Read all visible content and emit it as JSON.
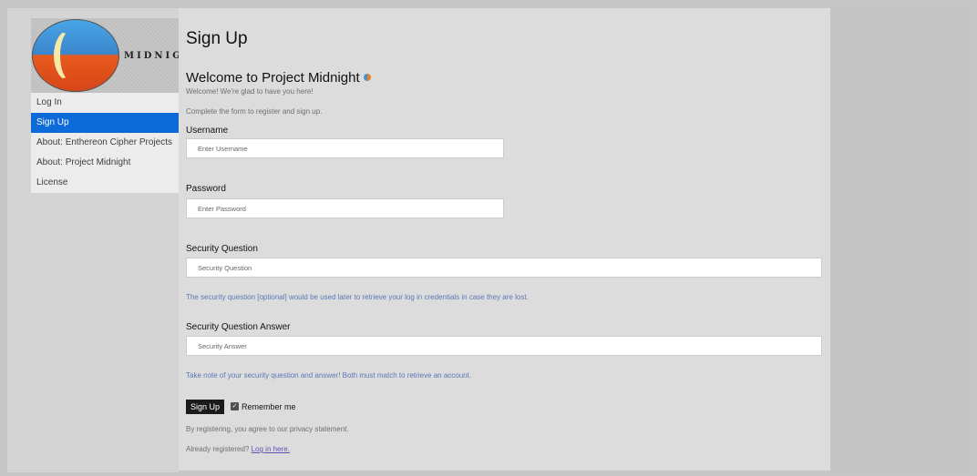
{
  "brand": {
    "logo_text": "MIDNIGHT"
  },
  "nav": {
    "items": [
      {
        "label": "Log In"
      },
      {
        "label": "Sign Up"
      },
      {
        "label": "About: Enthereon Cipher Projects"
      },
      {
        "label": "About: Project Midnight"
      },
      {
        "label": "License"
      }
    ]
  },
  "page": {
    "title": "Sign Up",
    "subtitle": "Welcome to Project Midnight",
    "welcome_text": "Welcome! We're glad to have you here!",
    "instructions": "Complete the form to register and sign up."
  },
  "form": {
    "username": {
      "label": "Username",
      "placeholder": "Enter Username",
      "value": ""
    },
    "password": {
      "label": "Password",
      "placeholder": "Enter Password",
      "value": ""
    },
    "security_question": {
      "label": "Security Question",
      "placeholder": "Security Question",
      "value": ""
    },
    "security_hint": "The security question [optional] would be used later to retrieve your log in credentials in case they are lost.",
    "security_answer": {
      "label": "Security Question Answer",
      "placeholder": "Security Answer",
      "value": ""
    },
    "answer_hint": "Take note of your security question and answer! Both must match to retrieve an account.",
    "submit_label": "Sign Up",
    "remember_label": "Remember me",
    "remember_checked": true,
    "agreement": "By registering, you agree to our privacy statement.",
    "already_registered": "Already registered?",
    "login_link": "Log in here."
  },
  "colors": {
    "active_nav": "#0d6ad9",
    "hint_text": "#5a78b8",
    "button": "#1b1b1b"
  }
}
